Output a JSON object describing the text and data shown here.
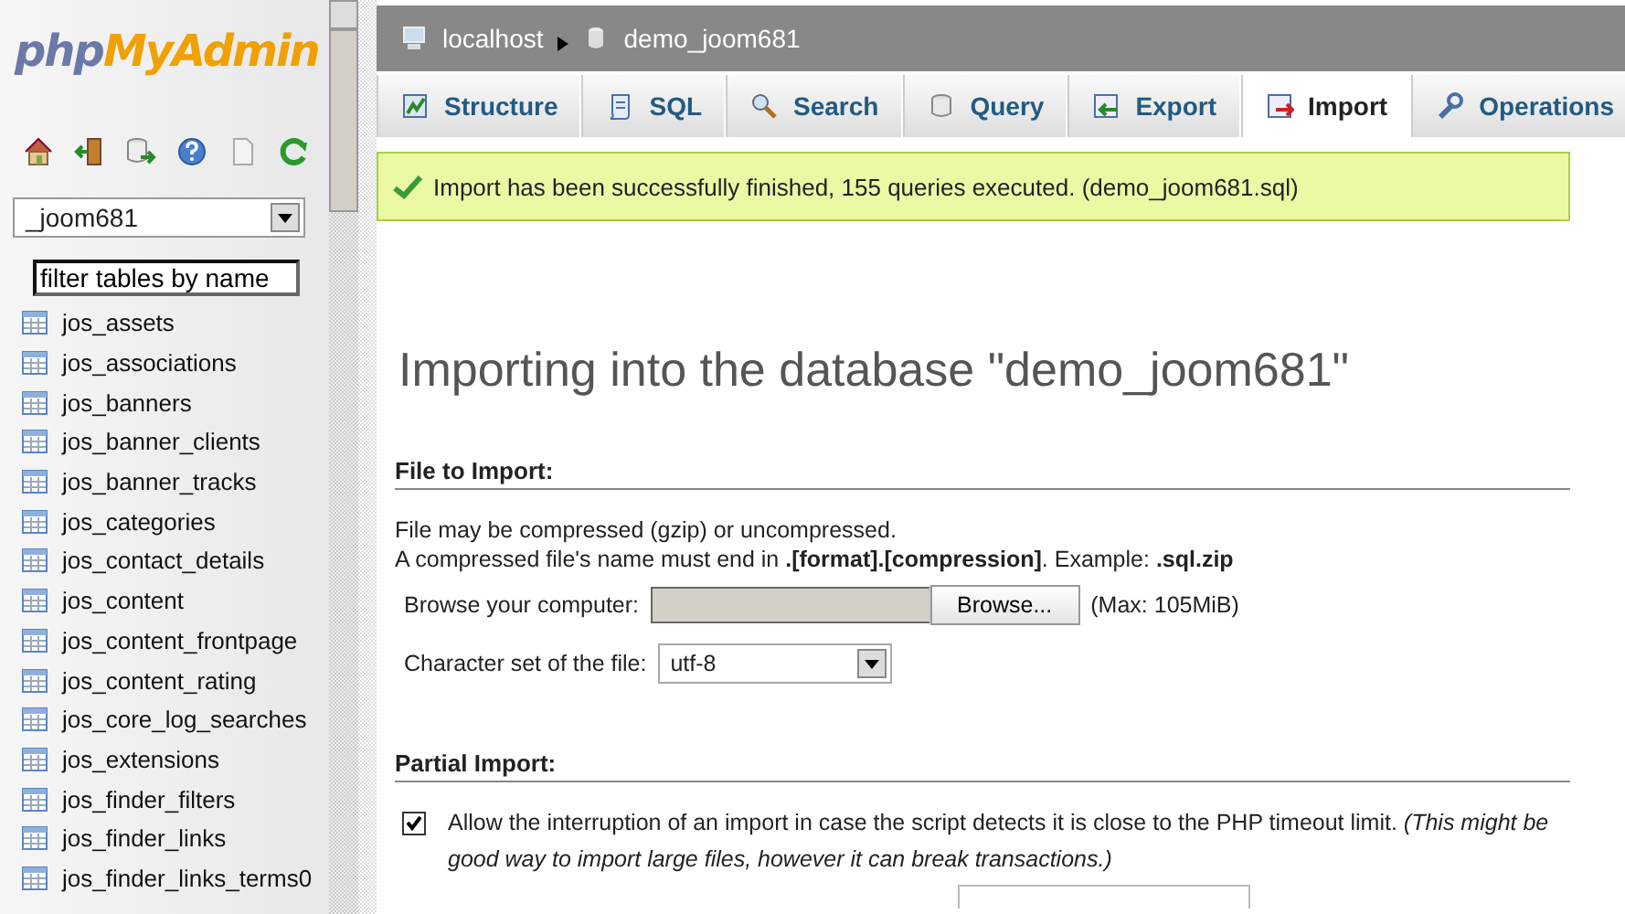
{
  "sidebar": {
    "logo": {
      "part_1": "php",
      "part_2": "MyAdmin"
    },
    "database_select": {
      "value": "_joom681"
    },
    "filter": {
      "value": "filter tables by name"
    },
    "tables": [
      "jos_assets",
      "jos_associations",
      "jos_banners",
      "jos_banner_clients",
      "jos_banner_tracks",
      "jos_categories",
      "jos_contact_details",
      "jos_content",
      "jos_content_frontpage",
      "jos_content_rating",
      "jos_core_log_searches",
      "jos_extensions",
      "jos_finder_filters",
      "jos_finder_links",
      "jos_finder_links_terms0"
    ]
  },
  "breadcrumb": [
    "localhost",
    "demo_joom681"
  ],
  "tabs": [
    {
      "label": "Structure",
      "kind": "structure",
      "selected": false
    },
    {
      "label": "SQL",
      "kind": "sql",
      "selected": false
    },
    {
      "label": "Search",
      "kind": "search",
      "selected": false
    },
    {
      "label": "Query",
      "kind": "query",
      "selected": false
    },
    {
      "label": "Export",
      "kind": "export",
      "selected": false
    },
    {
      "label": "Import",
      "kind": "import",
      "selected": true
    },
    {
      "label": "Operations",
      "kind": "operations",
      "selected": false
    }
  ],
  "success_message": "Import has been successfully finished, 155 queries executed. (demo_joom681.sql)",
  "heading": "Importing into the database \"demo_joom681\"",
  "file_section": {
    "title": "File to Import:",
    "line_1": "File may be compressed (gzip) or uncompressed.",
    "line_2": "A compressed file's name must end in **.[format].[compression]**. Example: **.sql.zip**",
    "browse_label": "Browse your computer:",
    "browse_button": "Browse...",
    "max_size": "(Max: 105MiB)",
    "charset_label": "Character set of the file:",
    "charset_value": "utf-8"
  },
  "partial_section": {
    "title": "Partial Import:",
    "allow_interrupt": {
      "checked": true,
      "text": "Allow the interruption of an import in case the script detects it is close to the PHP timeout limit. *(This might be good way to import large files, however it can break transactions.)*"
    }
  }
}
